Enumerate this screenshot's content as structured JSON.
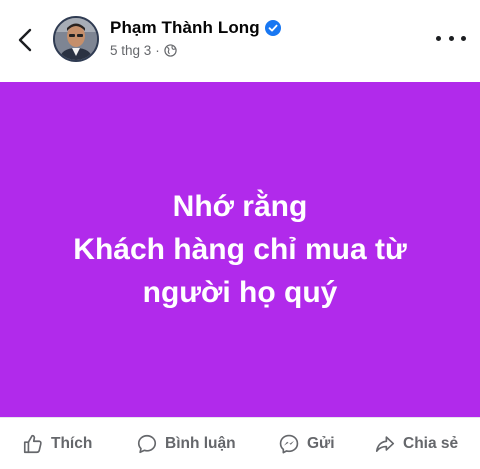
{
  "header": {
    "author_name": "Phạm Thành Long",
    "timestamp": "5 thg 3",
    "separator": "·",
    "back_icon": "chevron-left-icon",
    "verified_icon": "verified-badge-icon",
    "privacy_icon": "globe-icon",
    "more_icon": "more-horizontal-icon"
  },
  "card": {
    "background": "#b12aeb",
    "text_color": "#ffffff",
    "lines": [
      "Nhớ rằng",
      "Khách hàng chỉ mua từ",
      "người họ quý"
    ]
  },
  "actions": [
    {
      "label": "Thích",
      "icon": "like-icon"
    },
    {
      "label": "Bình luận",
      "icon": "comment-icon"
    },
    {
      "label": "Gửi",
      "icon": "messenger-icon"
    },
    {
      "label": "Chia sẻ",
      "icon": "share-icon"
    }
  ],
  "colors": {
    "verified": "#1877f2",
    "secondary_text": "#65676b"
  }
}
